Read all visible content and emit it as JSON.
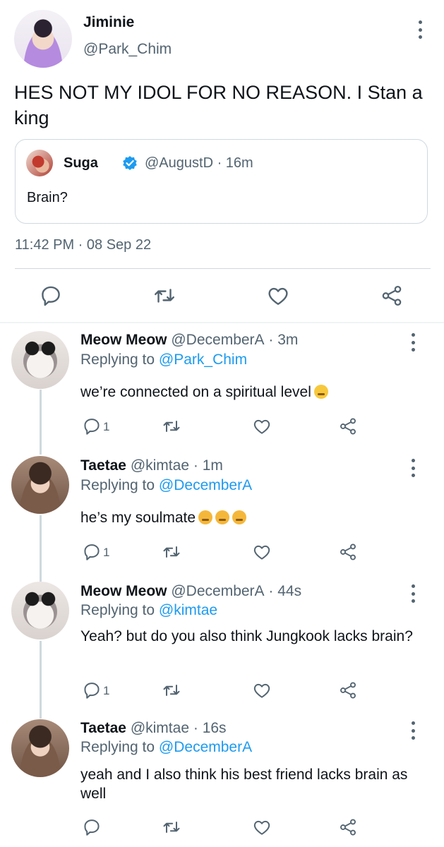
{
  "main_tweet": {
    "display_name": "Jiminie",
    "handle": "@Park_Chim",
    "text": "HES NOT MY IDOL FOR NO REASON. I Stan a king",
    "timestamp": "11:42 PM · 08 Sep 22",
    "quote": {
      "display_name": "Suga",
      "handle": "@AugustD",
      "time": "16m",
      "text": "Brain?"
    }
  },
  "replies": [
    {
      "display_name": "Meow Meow",
      "handle": "@DecemberA",
      "time": "3m",
      "replying_prefix": "Replying to ",
      "replying_to": "@Park_Chim",
      "text": "we’re connected on a spiritual level",
      "emoji": [
        "relieved"
      ],
      "reply_count": "1"
    },
    {
      "display_name": "Taetae",
      "handle": "@kimtae",
      "time": "1m",
      "replying_prefix": "Replying to ",
      "replying_to": "@DecemberA",
      "text": "he’s my soulmate",
      "emoji": [
        "huffing",
        "huffing",
        "huffing"
      ],
      "reply_count": "1"
    },
    {
      "display_name": "Meow Meow",
      "handle": "@DecemberA",
      "time": "44s",
      "replying_prefix": "Replying to ",
      "replying_to": "@kimtae",
      "text": "Yeah? but do you also think Jungkook lacks brain?",
      "reply_count": "1"
    },
    {
      "display_name": "Taetae",
      "handle": "@kimtae",
      "time": "16s",
      "replying_prefix": "Replying to ",
      "replying_to": "@DecemberA",
      "text": "yeah and I also think his best friend lacks brain as well",
      "reply_count": ""
    }
  ],
  "colors": {
    "text_primary": "#0f1419",
    "text_secondary": "#536471",
    "link": "#1d9bf0",
    "border": "#cfd9de"
  },
  "icons": [
    "reply-icon",
    "retweet-icon",
    "like-icon",
    "share-icon",
    "more-icon",
    "verified-badge-icon"
  ]
}
